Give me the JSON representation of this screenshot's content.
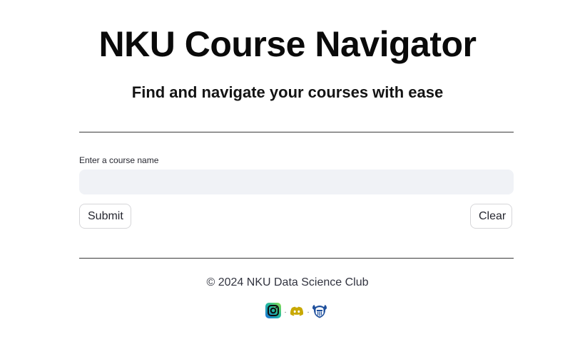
{
  "header": {
    "title": "NKU Course Navigator",
    "subtitle": "Find and navigate your courses with ease"
  },
  "search": {
    "label": "Enter a course name",
    "value": "",
    "placeholder": ""
  },
  "actions": {
    "submit_label": "Submit",
    "clear_label": "Clear"
  },
  "footer": {
    "copyright": "© 2024 NKU Data Science Club",
    "separator": ".",
    "links": [
      {
        "icon": "instagram-icon"
      },
      {
        "icon": "discord-icon"
      },
      {
        "icon": "nku-norse-logo-icon"
      }
    ]
  },
  "colors": {
    "input_background": "#f0f2f6",
    "button_border": "#d6d6d9",
    "discord_yellow": "#c8a800",
    "norse_blue": "#1e4f9c"
  }
}
